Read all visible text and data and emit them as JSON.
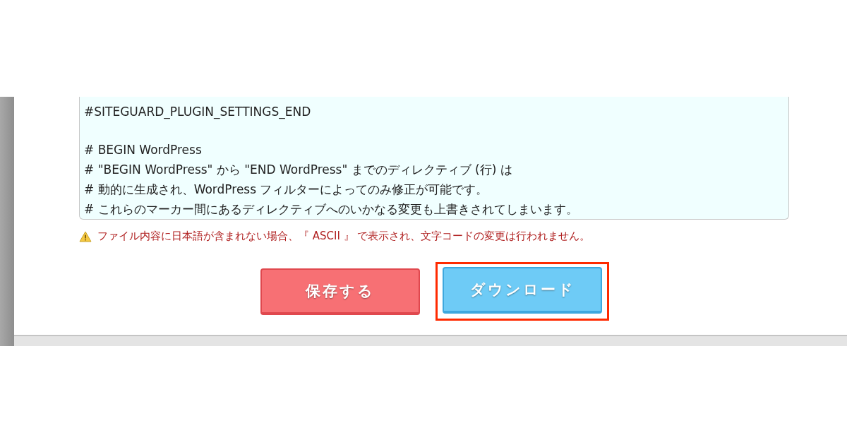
{
  "editor": {
    "lines": [
      {
        "text": "#SITEGUARD_PLUGIN_SETTINGS_END"
      },
      {
        "kind": "blank"
      },
      {
        "text": "# BEGIN WordPress"
      },
      {
        "text": "# \"BEGIN WordPress\" から \"END WordPress\" までのディレクティブ (行) は"
      },
      {
        "text": "# 動的に生成され、WordPress フィルターによってのみ修正が可能です。"
      },
      {
        "text": "# これらのマーカー間にあるディレクティブへのいかなる変更も上書きされてしまいます。"
      }
    ]
  },
  "warning": {
    "text": "ファイル内容に日本語が含まれない場合、『 ASCII 』 で表示され、文字コードの変更は行われません。"
  },
  "buttons": [
    {
      "label": "保存する",
      "kind": "save",
      "highlighted": false
    },
    {
      "label": "ダウンロード",
      "kind": "download",
      "highlighted": true
    }
  ]
}
